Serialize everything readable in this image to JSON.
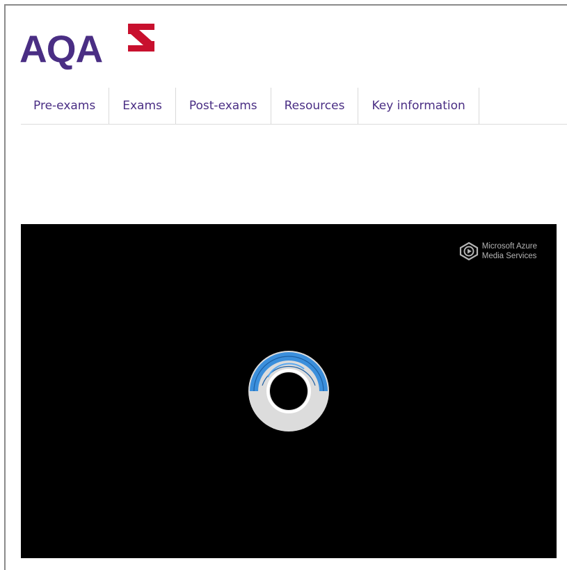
{
  "logo": {
    "text": "AQA",
    "mark_color": "#c8102e",
    "text_color": "#4a2e84"
  },
  "nav": {
    "items": [
      {
        "label": "Pre-exams"
      },
      {
        "label": "Exams"
      },
      {
        "label": "Post-exams"
      },
      {
        "label": "Resources"
      },
      {
        "label": "Key information"
      }
    ]
  },
  "player": {
    "brand_line1": "Microsoft Azure",
    "brand_line2": "Media Services",
    "brand_icon": "azure-media-services-icon",
    "spinner_icon": "loading-spinner-icon",
    "spinner_color": "#3b8fdc",
    "background": "#000000"
  }
}
